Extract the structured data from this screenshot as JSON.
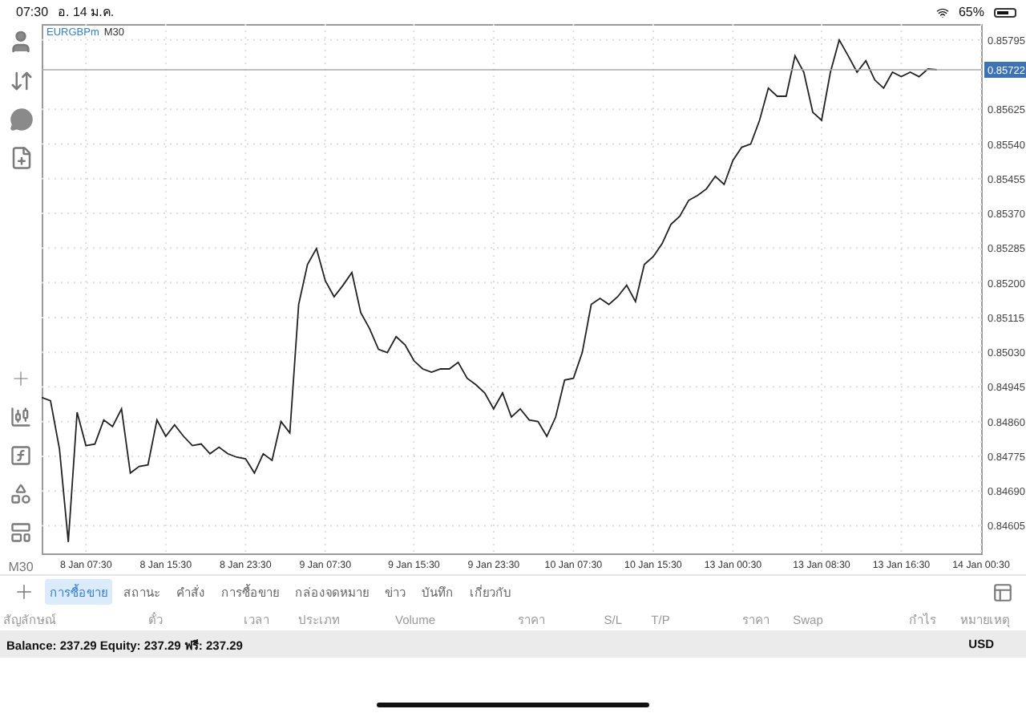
{
  "status_bar": {
    "time": "07:30",
    "date": "อ. 14 ม.ค.",
    "battery": "65%"
  },
  "chart": {
    "timeframe": "M30",
    "current_price": "0.85722",
    "chart_data": {
      "type": "line",
      "grid": true,
      "categories": [
        null,
        null,
        null,
        null,
        null,
        "8 Jan 07:30",
        null,
        null,
        null,
        null,
        null,
        null,
        null,
        null,
        "8 Jan 15:30",
        null,
        null,
        null,
        null,
        null,
        null,
        null,
        null,
        "8 Jan 23:30",
        null,
        null,
        null,
        null,
        null,
        null,
        null,
        null,
        "9 Jan 07:30",
        null,
        null,
        null,
        null,
        null,
        null,
        null,
        null,
        null,
        "9 Jan 15:30",
        null,
        null,
        null,
        null,
        null,
        null,
        null,
        null,
        "9 Jan 23:30",
        null,
        null,
        null,
        null,
        null,
        null,
        null,
        null,
        "10 Jan 07:30",
        null,
        null,
        null,
        null,
        null,
        null,
        null,
        null,
        "10 Jan 15:30",
        null,
        null,
        null,
        null,
        null,
        null,
        null,
        null,
        "13 Jan 00:30",
        null,
        null,
        null,
        null,
        null,
        null,
        null,
        null,
        null,
        "13 Jan 08:30",
        null,
        null,
        null,
        null,
        null,
        null,
        null,
        null,
        "13 Jan 16:30",
        null,
        null,
        null,
        null,
        null,
        null,
        null,
        null,
        "14 Jan 00:30"
      ],
      "ref_lines": [
        {
          "axis": "y",
          "value": 0.85722,
          "color": "#aaaaaa"
        }
      ],
      "series": [
        {
          "name": "EURGBPm",
          "color": "#222222",
          "values": [
            0.84919,
            0.84911,
            0.84793,
            0.84565,
            0.84883,
            0.84801,
            0.84805,
            0.84864,
            0.84848,
            0.84891,
            0.84734,
            0.8475,
            0.84754,
            0.84864,
            0.84824,
            0.84852,
            0.84824,
            0.84801,
            0.84805,
            0.84781,
            0.84797,
            0.84781,
            0.84773,
            0.84769,
            0.84734,
            0.84781,
            0.84765,
            0.8486,
            0.84832,
            0.85147,
            0.85245,
            0.85284,
            0.85205,
            0.85166,
            0.85194,
            0.85225,
            0.85127,
            0.85088,
            0.85037,
            0.85029,
            0.85068,
            0.85048,
            0.85009,
            0.84989,
            0.84981,
            0.84989,
            0.84989,
            0.85005,
            0.84966,
            0.8495,
            0.8493,
            0.84891,
            0.8493,
            0.84871,
            0.84891,
            0.84864,
            0.8486,
            0.84824,
            0.84871,
            0.84962,
            0.84966,
            0.85029,
            0.85147,
            0.85162,
            0.85147,
            0.85166,
            0.85194,
            0.85154,
            0.85245,
            0.85264,
            0.85296,
            0.85343,
            0.85363,
            0.85402,
            0.85414,
            0.8543,
            0.85461,
            0.85441,
            0.855,
            0.85532,
            0.8554,
            0.85598,
            0.85677,
            0.85657,
            0.85657,
            0.85756,
            0.85716,
            0.85618,
            0.85598,
            0.85716,
            0.85795,
            0.85756,
            0.85716,
            0.85744,
            0.85697,
            0.85677,
            0.85716,
            0.85705,
            0.85716,
            0.85705,
            0.85724,
            0.85722,
            null,
            null,
            null,
            null,
            null
          ]
        }
      ],
      "ylim": [
        0.84537,
        0.85834
      ],
      "yticks": [
        {
          "value": 0.84605,
          "label": "0.84605"
        },
        {
          "value": 0.8469,
          "label": "0.84690"
        },
        {
          "value": 0.84775,
          "label": "0.84775"
        },
        {
          "value": 0.8486,
          "label": "0.84860"
        },
        {
          "value": 0.84945,
          "label": "0.84945"
        },
        {
          "value": 0.8503,
          "label": "0.85030"
        },
        {
          "value": 0.85115,
          "label": "0.85115"
        },
        {
          "value": 0.852,
          "label": "0.85200"
        },
        {
          "value": 0.85285,
          "label": "0.85285"
        },
        {
          "value": 0.8537,
          "label": "0.85370"
        },
        {
          "value": 0.85455,
          "label": "0.85455"
        },
        {
          "value": 0.8554,
          "label": "0.85540"
        },
        {
          "value": 0.85625,
          "label": "0.85625"
        },
        {
          "value": 0.85795,
          "label": "0.85795"
        }
      ]
    }
  },
  "toolbar": {
    "timeframe_label": "M30"
  },
  "tabs": [
    {
      "label": "การซื้อขาย",
      "selected": true
    },
    {
      "label": "สถานะ",
      "selected": false
    },
    {
      "label": "คำสั่ง",
      "selected": false
    },
    {
      "label": "การซื้อขาย",
      "selected": false
    },
    {
      "label": "กล่องจดหมาย",
      "selected": false
    },
    {
      "label": "ข่าว",
      "selected": false
    },
    {
      "label": "บันทึก",
      "selected": false
    },
    {
      "label": "เกี่ยวกับ",
      "selected": false
    }
  ],
  "table": {
    "columns": [
      "สัญลักษณ์",
      "ตั๋ว",
      "เวลา",
      "ประเภท",
      "Volume",
      "ราคา",
      "S/L",
      "T/P",
      "ราคา",
      "Swap",
      "กำไร",
      "หมายเหตุ"
    ]
  },
  "summary": {
    "text": "Balance: 237.29 Equity: 237.29 ฟรี: 237.29",
    "currency": "USD"
  }
}
